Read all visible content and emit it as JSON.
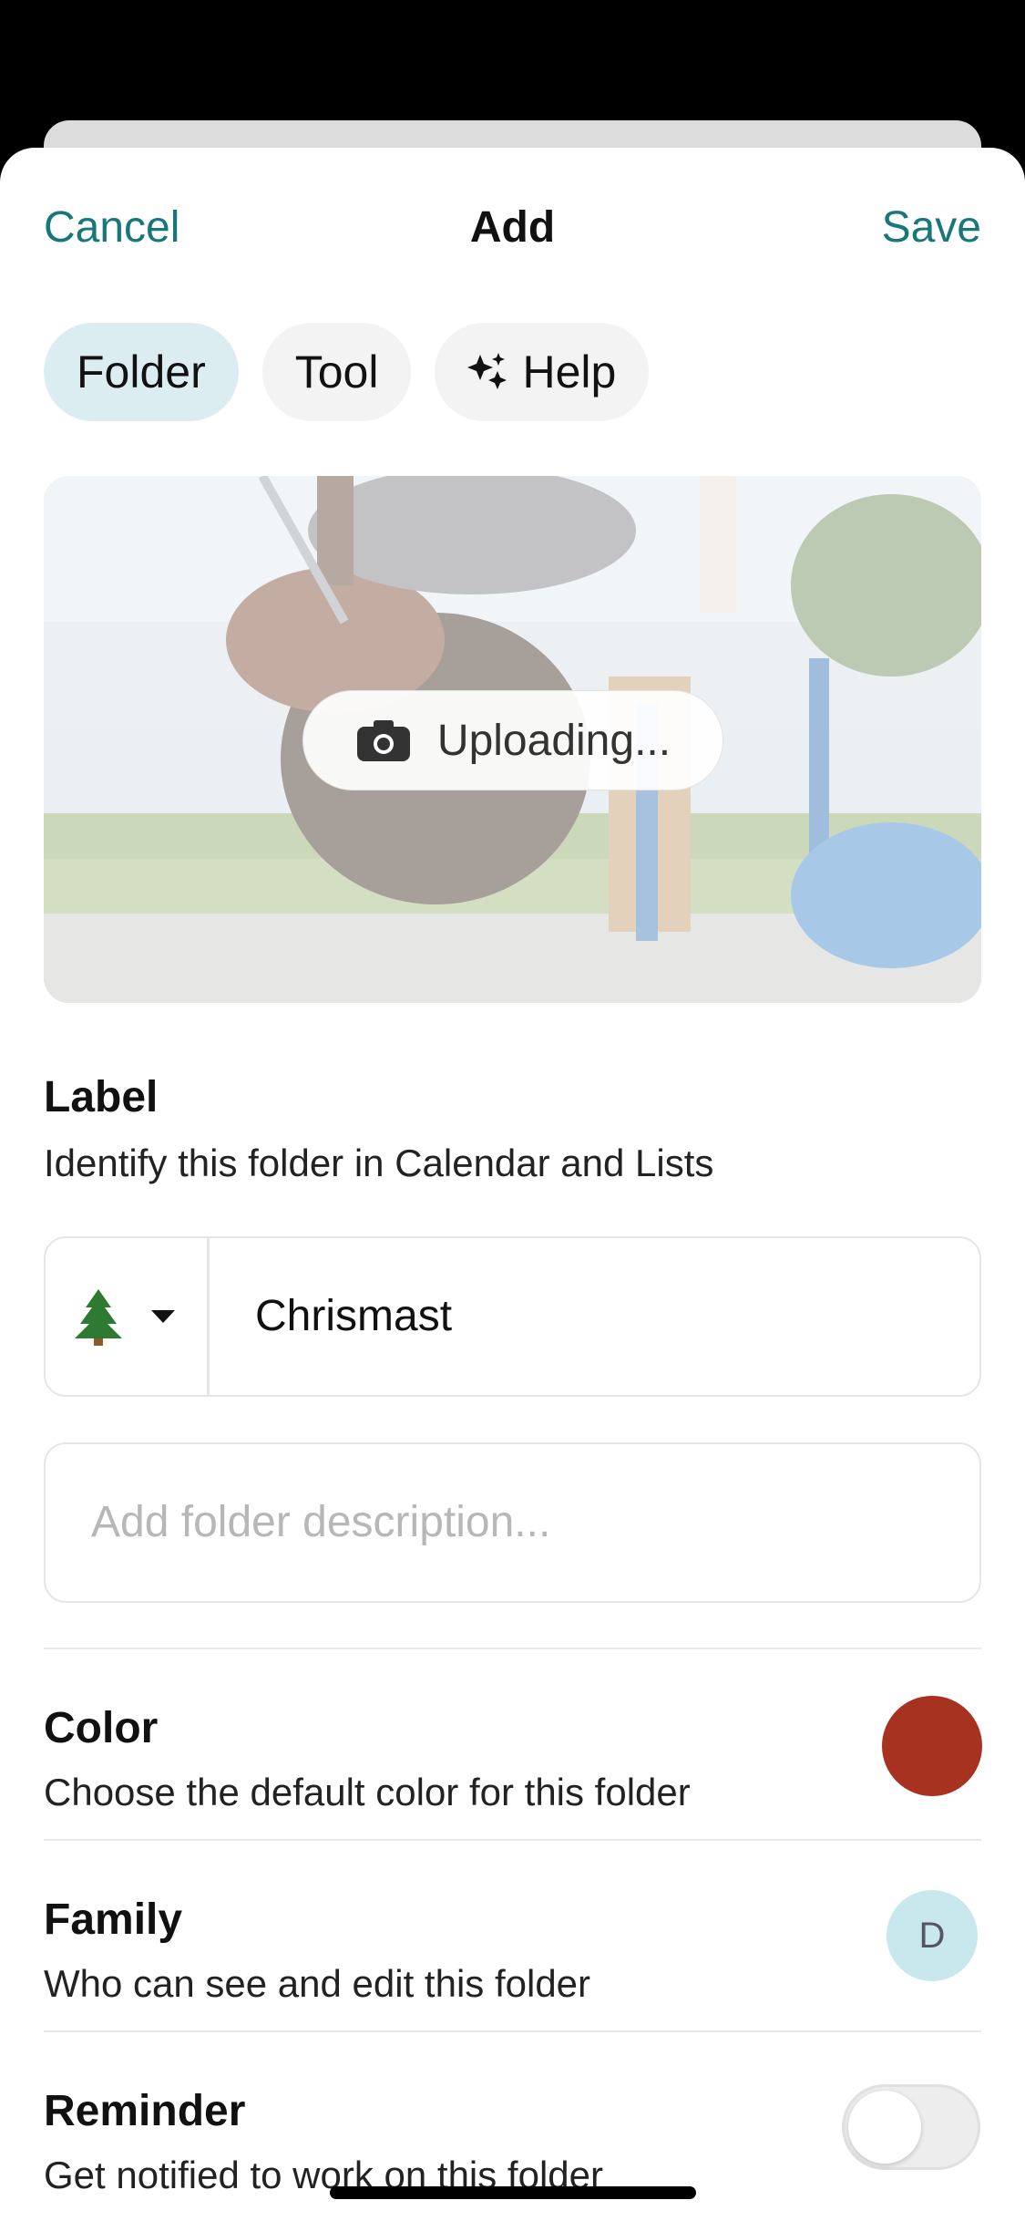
{
  "nav": {
    "cancel_label": "Cancel",
    "title": "Add",
    "save_label": "Save"
  },
  "tabs": [
    {
      "label": "Folder",
      "active": true
    },
    {
      "label": "Tool",
      "active": false
    },
    {
      "label": "Help",
      "active": false,
      "icon": "sparkles-icon"
    }
  ],
  "photo": {
    "status_label": "Uploading...",
    "icon": "camera-icon"
  },
  "label_section": {
    "title": "Label",
    "subtitle": "Identify this folder in Calendar and Lists",
    "emoji_icon": "christmas-tree-icon",
    "value": "Chrismast"
  },
  "description": {
    "placeholder": "Add folder description..."
  },
  "color_section": {
    "title": "Color",
    "subtitle": "Choose the default color for this folder",
    "color": "#a7321f"
  },
  "family_section": {
    "title": "Family",
    "subtitle": "Who can see and edit this folder",
    "avatar_initial": "D"
  },
  "reminder_section": {
    "title": "Reminder",
    "subtitle": "Get notified to work on this folder",
    "enabled": false
  },
  "colors": {
    "accent": "#19777a",
    "active_tab": "#dcedf2",
    "avatar_bg": "#c9e8ee"
  }
}
